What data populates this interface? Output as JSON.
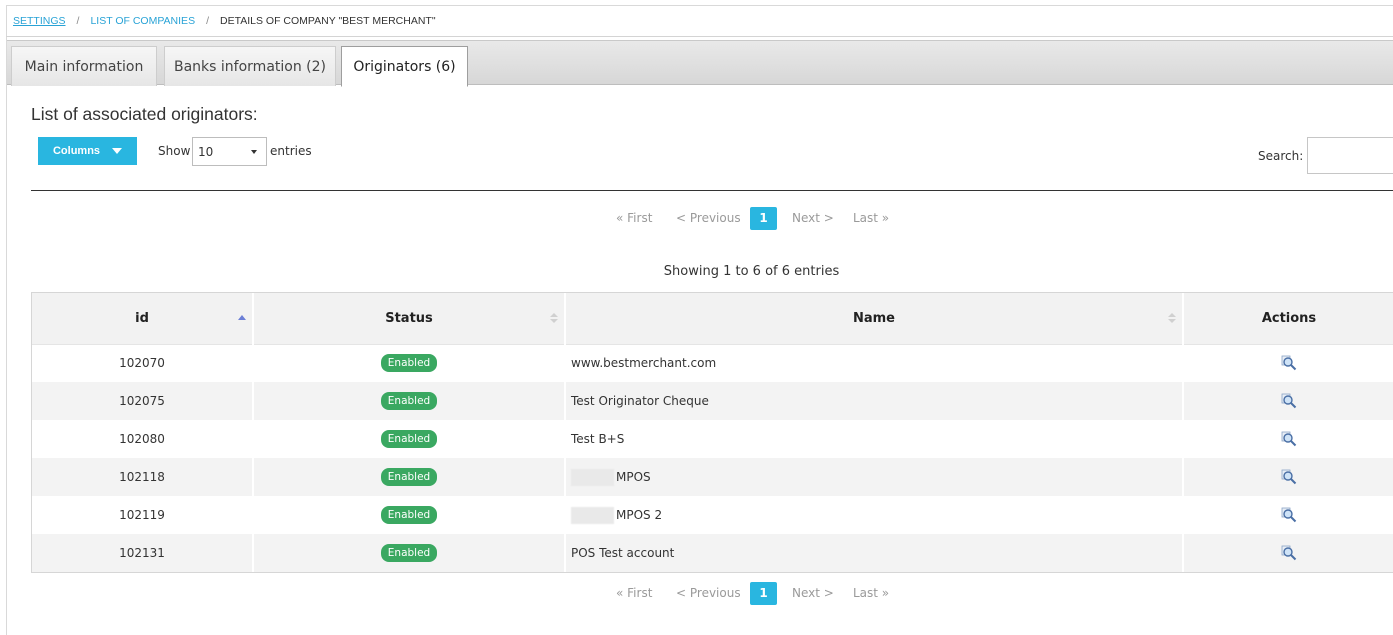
{
  "breadcrumb": {
    "items": [
      "SETTINGS",
      "LIST OF COMPANIES",
      "DETAILS OF COMPANY \"BEST MERCHANT\""
    ],
    "separator": "/"
  },
  "tabs": [
    {
      "label": "Main information",
      "active": false
    },
    {
      "label": "Banks information (2)",
      "active": false
    },
    {
      "label": "Originators (6)",
      "active": true
    }
  ],
  "section_title": "List of associated originators:",
  "toolbar": {
    "columns_label": "Columns",
    "show_label": "Show",
    "entries_value": "10",
    "entries_label": "entries",
    "search_label": "Search:",
    "search_value": ""
  },
  "pagination": {
    "first": "« First",
    "previous": "< Previous",
    "current": "1",
    "next": "Next >",
    "last": "Last »"
  },
  "showing_info": "Showing 1 to 6 of 6 entries",
  "table": {
    "headers": [
      "id",
      "Status",
      "Name",
      "Actions"
    ],
    "rows": [
      {
        "id": "102070",
        "status": "Enabled",
        "name": "www.bestmerchant.com",
        "redacted": false
      },
      {
        "id": "102075",
        "status": "Enabled",
        "name": "Test Originator Cheque",
        "redacted": false
      },
      {
        "id": "102080",
        "status": "Enabled",
        "name": "Test B+S",
        "redacted": false
      },
      {
        "id": "102118",
        "status": "Enabled",
        "name": "MPOS",
        "redacted": true
      },
      {
        "id": "102119",
        "status": "Enabled",
        "name": "MPOS 2",
        "redacted": true
      },
      {
        "id": "102131",
        "status": "Enabled",
        "name": "POS Test account",
        "redacted": false
      }
    ]
  },
  "colors": {
    "accent": "#29b6e0",
    "link": "#29a3d6",
    "badge_enabled": "#3aa861",
    "row_alt": "#f3f3f3",
    "header_bg": "#f2f2f2"
  },
  "icons": {
    "sort_id": "sort-asc-icon",
    "sort_other": "sort-both-icon",
    "action": "magnifier-view-icon",
    "columns_caret": "caret-down-icon"
  }
}
